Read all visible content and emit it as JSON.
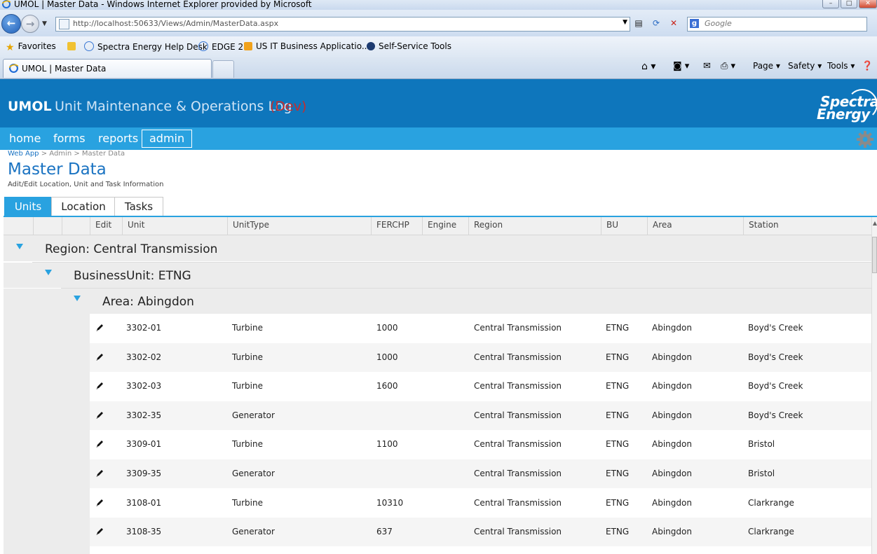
{
  "window": {
    "title": "UMOL | Master Data - Windows Internet Explorer provided by Microsoft",
    "minimize": "–",
    "maximize": "□",
    "close": "✕"
  },
  "browser": {
    "url": "http://localhost:50633/Views/Admin/MasterData.aspx",
    "search_placeholder": "Google",
    "favorites_label": "Favorites",
    "favorites": [
      "Spectra Energy Help Desk",
      "EDGE 2",
      "US IT Business Applicatio...",
      "Self-Service Tools"
    ],
    "tab_title": "UMOL | Master Data",
    "commands": {
      "page": "Page ▾",
      "safety": "Safety ▾",
      "tools": "Tools ▾"
    }
  },
  "app": {
    "abbr": "UMOL",
    "name": "Unit Maintenance & Operations Log",
    "env": "(Dev)",
    "logo_line1": "Spectra",
    "logo_line2": "Energy"
  },
  "nav": {
    "home": "home",
    "forms": "forms",
    "reports": "reports",
    "admin": "admin"
  },
  "breadcrumb": {
    "root": "Web App",
    "sep1": " > ",
    "admin": "Admin",
    "sep2": " > ",
    "current": "Master Data"
  },
  "page": {
    "title": "Master Data",
    "subtitle": "Adit/Edit Location, Unit and Task Information"
  },
  "tabs": [
    "Units",
    "Location",
    "Tasks"
  ],
  "grid": {
    "columns": [
      "Edit",
      "Unit",
      "UnitType",
      "FERCHP",
      "Engine",
      "Region",
      "BU",
      "Area",
      "Station"
    ],
    "groups": {
      "region": "Region: Central Transmission",
      "bu": "BusinessUnit: ETNG",
      "area": "Area: Abingdon"
    },
    "rows": [
      {
        "unit": "3302-01",
        "type": "Turbine",
        "ferchp": "1000",
        "engine": "",
        "region": "Central Transmission",
        "bu": "ETNG",
        "area": "Abingdon",
        "station": "Boyd's Creek"
      },
      {
        "unit": "3302-02",
        "type": "Turbine",
        "ferchp": "1000",
        "engine": "",
        "region": "Central Transmission",
        "bu": "ETNG",
        "area": "Abingdon",
        "station": "Boyd's Creek"
      },
      {
        "unit": "3302-03",
        "type": "Turbine",
        "ferchp": "1600",
        "engine": "",
        "region": "Central Transmission",
        "bu": "ETNG",
        "area": "Abingdon",
        "station": "Boyd's Creek"
      },
      {
        "unit": "3302-35",
        "type": "Generator",
        "ferchp": "",
        "engine": "",
        "region": "Central Transmission",
        "bu": "ETNG",
        "area": "Abingdon",
        "station": "Boyd's Creek"
      },
      {
        "unit": "3309-01",
        "type": "Turbine",
        "ferchp": "1100",
        "engine": "",
        "region": "Central Transmission",
        "bu": "ETNG",
        "area": "Abingdon",
        "station": "Bristol"
      },
      {
        "unit": "3309-35",
        "type": "Generator",
        "ferchp": "",
        "engine": "",
        "region": "Central Transmission",
        "bu": "ETNG",
        "area": "Abingdon",
        "station": "Bristol"
      },
      {
        "unit": "3108-01",
        "type": "Turbine",
        "ferchp": "10310",
        "engine": "",
        "region": "Central Transmission",
        "bu": "ETNG",
        "area": "Abingdon",
        "station": "Clarkrange"
      },
      {
        "unit": "3108-35",
        "type": "Generator",
        "ferchp": "637",
        "engine": "",
        "region": "Central Transmission",
        "bu": "ETNG",
        "area": "Abingdon",
        "station": "Clarkrange"
      }
    ]
  },
  "colors": {
    "header_blue": "#0e76bc",
    "nav_blue": "#29a2e0",
    "title_blue": "#1a73c2",
    "env_red": "#c72c2c"
  }
}
